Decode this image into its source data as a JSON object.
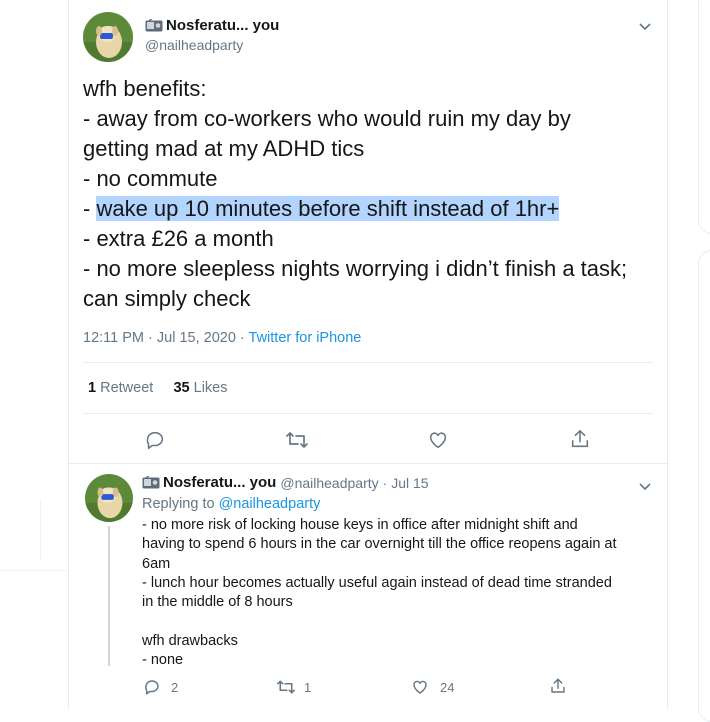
{
  "main_tweet": {
    "display_name": "Nosferatu... you",
    "handle": "@nailheadparty",
    "text_lines": [
      "wfh benefits:",
      "- away from co-workers who would ruin my day by",
      "getting mad at my ADHD tics",
      "- no commute",
      "- ",
      "- extra £26 a month",
      "- no more sleepless nights worrying i didn’t finish a task;",
      "can simply check"
    ],
    "highlighted_text": "wake up 10 minutes before shift instead of 1hr+",
    "timestamp": "12:11 PM · Jul 15, 2020 · ",
    "source": "Twitter for iPhone",
    "retweet_count": "1",
    "retweet_label": "Retweet",
    "like_count": "35",
    "like_label": "Likes",
    "icons": [
      "reply-icon",
      "retweet-icon",
      "like-icon",
      "share-icon"
    ]
  },
  "reply_tweet": {
    "display_name": "Nosferatu... you",
    "handle": "@nailheadparty",
    "date": "· Jul 15",
    "replying_prefix": "Replying to ",
    "replying_handle": "@nailheadparty",
    "text_lines": [
      "- no more risk of locking house keys in office after midnight shift and",
      "having to spend 6 hours in the car overnight till the office reopens again at",
      "6am",
      "- lunch hour becomes actually useful again instead of dead time stranded",
      "in the middle of 8 hours",
      "",
      "wfh drawbacks",
      "- none"
    ],
    "reply_count": "2",
    "retweet_count": "1",
    "like_count": "24"
  },
  "colors": {
    "text": "#14171a",
    "secondary": "#657786",
    "link": "#1b95e0",
    "highlight": "#b3d4fc",
    "border": "#e6ecf0"
  }
}
